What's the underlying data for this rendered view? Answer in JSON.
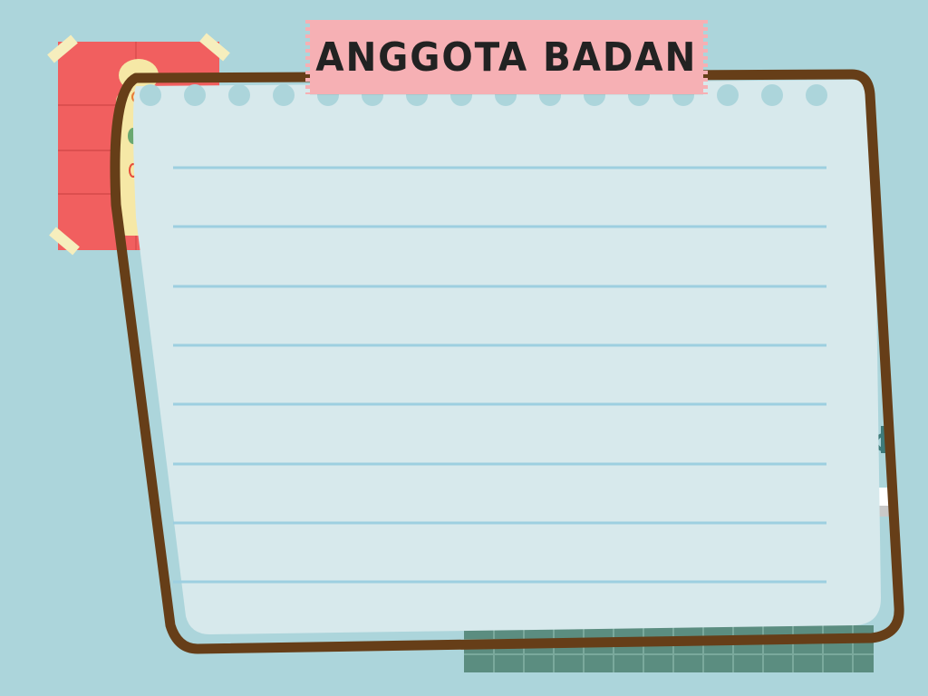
{
  "title": "ANGGOTA BADAN",
  "colors": {
    "background": "#acd5db",
    "paper": "#d7e9ec",
    "frame": "#663e18",
    "tape_title": "#f6b0b4",
    "sticky_note": "#f15f5f",
    "ruled_line": "#9dcfe0",
    "tile_panel": "#5b8d80"
  },
  "icons": [
    "body-anatomy-illustration",
    "washi-tape",
    "binder-holes"
  ]
}
